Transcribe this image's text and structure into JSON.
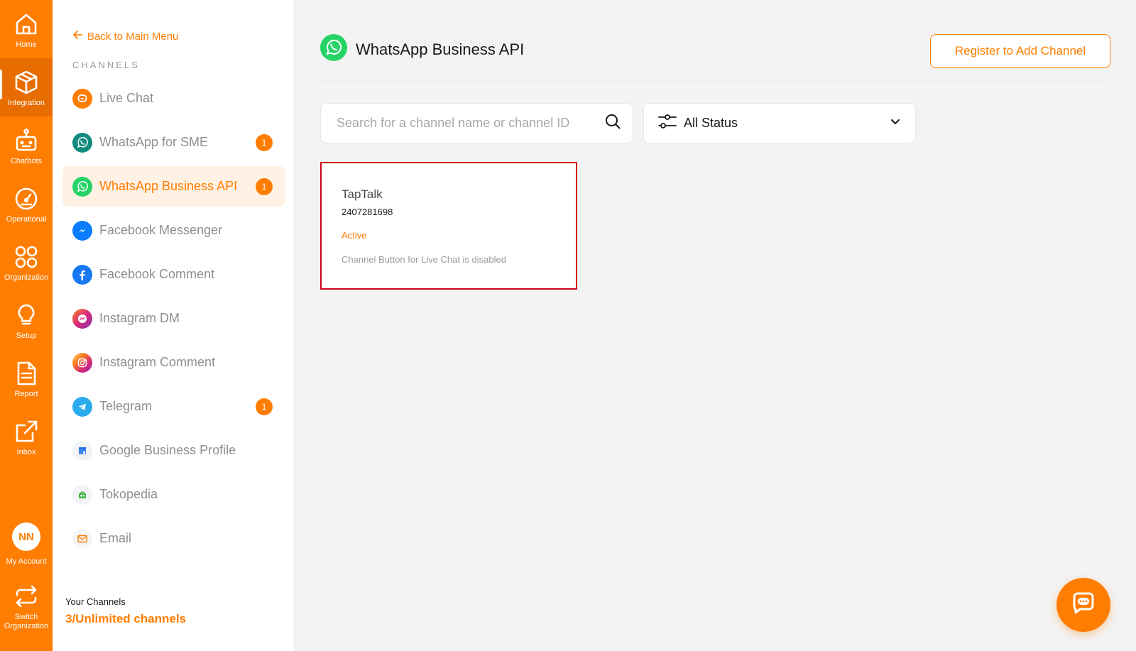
{
  "colors": {
    "accent": "#ff7d00",
    "card_border": "#d0021b",
    "whatsapp_green": "#25d366"
  },
  "rail": {
    "items": [
      {
        "label": "Home",
        "icon": "home-icon"
      },
      {
        "label": "Integration",
        "icon": "cube-icon"
      },
      {
        "label": "Chatbots",
        "icon": "robot-icon"
      },
      {
        "label": "Operational",
        "icon": "gauge-icon"
      },
      {
        "label": "Organization",
        "icon": "grid-circles-icon"
      },
      {
        "label": "Setup",
        "icon": "lightbulb-icon"
      },
      {
        "label": "Report",
        "icon": "document-icon"
      },
      {
        "label": "Inbox",
        "icon": "external-link-icon"
      }
    ],
    "active": "Integration",
    "account": {
      "initials": "NN",
      "label": "My Account"
    },
    "switch": {
      "label_line1": "Switch",
      "label_line2": "Organization",
      "icon": "swap-icon"
    }
  },
  "sidebar": {
    "back_label": "Back to Main Menu",
    "section_label": "CHANNELS",
    "items": [
      {
        "label": "Live Chat",
        "icon": "live-chat-icon",
        "badge": ""
      },
      {
        "label": "WhatsApp for SME",
        "icon": "whatsapp-sme-icon",
        "badge": "1"
      },
      {
        "label": "WhatsApp Business API",
        "icon": "whatsapp-icon",
        "badge": "1"
      },
      {
        "label": "Facebook Messenger",
        "icon": "messenger-icon",
        "badge": ""
      },
      {
        "label": "Facebook Comment",
        "icon": "facebook-icon",
        "badge": ""
      },
      {
        "label": "Instagram DM",
        "icon": "instagram-dm-icon",
        "badge": ""
      },
      {
        "label": "Instagram Comment",
        "icon": "instagram-icon",
        "badge": ""
      },
      {
        "label": "Telegram",
        "icon": "telegram-icon",
        "badge": "1"
      },
      {
        "label": "Google Business Profile",
        "icon": "google-business-icon",
        "badge": ""
      },
      {
        "label": "Tokopedia",
        "icon": "tokopedia-icon",
        "badge": ""
      },
      {
        "label": "Email",
        "icon": "email-icon",
        "badge": ""
      }
    ],
    "active": "WhatsApp Business API",
    "footer": {
      "title": "Your Channels",
      "value": "3/Unlimited channels"
    }
  },
  "main": {
    "title": "WhatsApp Business API",
    "register_label": "Register to Add Channel",
    "search": {
      "placeholder": "Search for a channel name or channel ID",
      "value": ""
    },
    "status_filter": {
      "selected": "All Status"
    },
    "cards": [
      {
        "name": "TapTalk",
        "id": "2407281698",
        "status": "Active",
        "note": "Channel Button for Live Chat is disabled"
      }
    ]
  }
}
